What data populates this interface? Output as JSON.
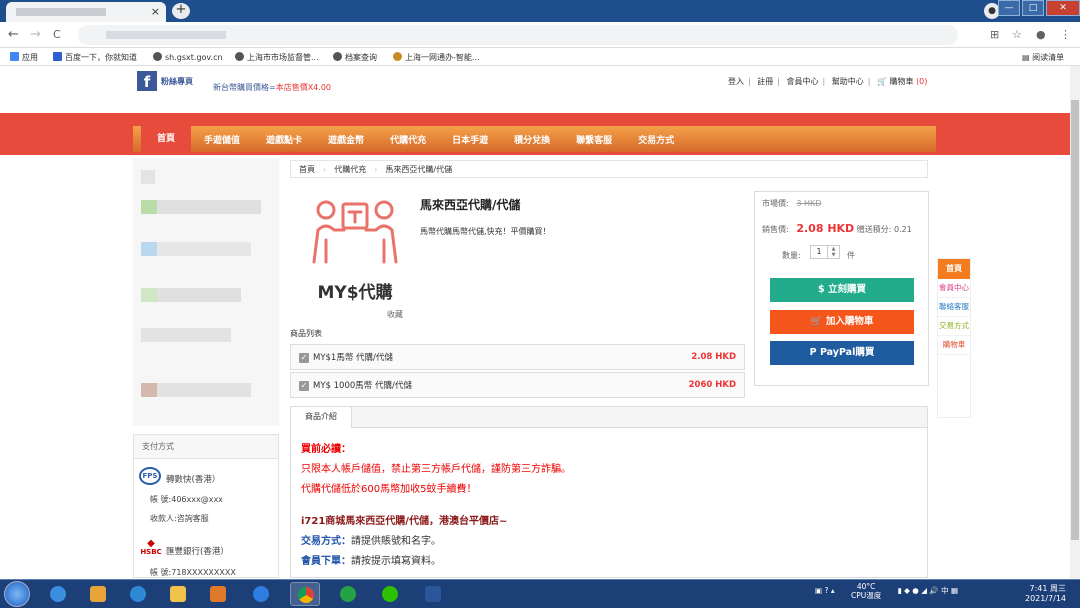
{
  "browser": {
    "new_tab": "+",
    "close_tab": "×",
    "back": "←",
    "forward": "→",
    "reload": "C",
    "win_controls": [
      "—",
      "□",
      "✕"
    ],
    "bookmarks": [
      {
        "label": "应用",
        "icon": "apps-grid-icon"
      },
      {
        "label": "百度一下，你就知道",
        "icon": "baidu-icon"
      },
      {
        "label": "sh.gsxt.gov.cn",
        "icon": "globe-icon"
      },
      {
        "label": "上海市市场监督管...",
        "icon": "globe-icon"
      },
      {
        "label": "档案查询",
        "icon": "globe-icon"
      },
      {
        "label": "上海一网通办-智能...",
        "icon": "shanghai-icon"
      }
    ],
    "reading_list": "阅读清单"
  },
  "header": {
    "fanpage": "粉絲專頁",
    "twd_label": "新台幣購買價格=",
    "twd_value": "本店售價X4.00",
    "links": [
      "登入",
      "註冊",
      "會員中心",
      "幫助中心"
    ],
    "cart_label": "購物車",
    "cart_count": "(0)"
  },
  "nav": [
    "首頁",
    "手遊儲值",
    "遊戲點卡",
    "遊戲金幣",
    "代購代充",
    "日本手遊",
    "積分兌換",
    "聯繫客服",
    "交易方式"
  ],
  "breadcrumb": [
    "首頁",
    "代購代充",
    "馬來西亞代購/代儲"
  ],
  "product": {
    "image_caption": "MY$代購",
    "fav": "收藏",
    "title": "馬來西亞代購/代儲",
    "desc": "馬幣代購馬幣代儲,快充！平價購買！",
    "list_label": "商品列表",
    "items": [
      {
        "name": "MY$1馬幣 代購/代儲",
        "price": "2.08 HKD"
      },
      {
        "name": "MY$ 1000馬幣 代購/代儲",
        "price": "2060 HKD"
      }
    ]
  },
  "pricing": {
    "market_label": "市場價:",
    "market_value": "3 HKD",
    "sale_label": "銷售價:",
    "sale_value": "2.08 HKD",
    "points": "贈送積分: 0.21",
    "qty_label": "數量:",
    "qty_value": "1",
    "qty_unit": "件",
    "buy": "$ 立刻購買",
    "add_cart": "加入購物車",
    "paypal": "PayPal購買"
  },
  "side_float": [
    "首頁",
    "會員中心",
    "聯絡客服",
    "交易方式",
    "購物車"
  ],
  "intro": {
    "tab": "商品介紹",
    "must_read": "買前必讀：",
    "line1": "只限本人帳戶儲值，禁止第三方帳戶代儲，謹防第三方詐騙。",
    "line2": "代購代儲低於600馬幣加收5蚊手續費！",
    "shop": "i721商城馬來西亞代購/代儲，港澳台平價店~",
    "trade_label": "交易方式：",
    "trade_text": "請提供賬號和名字。",
    "order_label": "會員下單：",
    "order_text": "請按提示填寫資料。"
  },
  "payment": {
    "title": "支付方式",
    "fps_logo": "FPS",
    "fps_name": "轉數快(香港）",
    "fps_account": "帳 號:406xxx@xxx",
    "fps_payee": "收款人:咨詢客服",
    "hsbc_logo": "HSBC",
    "hsbc_name": "匯豐銀行(香港）",
    "hsbc_account": "帳 號:718XXXXXXXXX"
  },
  "taskbar": {
    "temp": "40°C",
    "cpu": "CPU温度",
    "time": "7:41 周三",
    "date": "2021/7/14"
  },
  "colors": {
    "band_red": "#e64b3c",
    "nav_orange": "#f4a24a",
    "buy_green": "#22ac8c",
    "cart_orange": "#f4561c",
    "paypal_blue": "#1f5c9f",
    "price_red": "#e33"
  }
}
